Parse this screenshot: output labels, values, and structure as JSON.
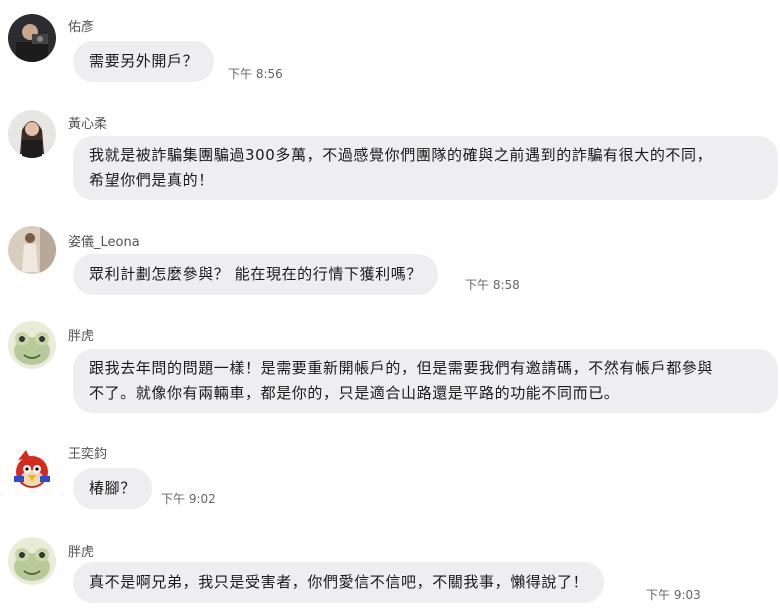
{
  "messages": [
    {
      "name": "佑彥",
      "avatar": "man-with-camera-avatar",
      "lines": [
        "需要另外開戶？"
      ],
      "time": "下午 8:56"
    },
    {
      "name": "黃心柔",
      "avatar": "woman-avatar",
      "lines": [
        "我就是被詐騙集團騙過300多萬，不過感覺你們團隊的確與之前遇到的詐騙有很大的不同，",
        "希望你們是真的！"
      ],
      "time": ""
    },
    {
      "name": "姿儀_Leona",
      "avatar": "woman-standing-avatar",
      "lines": [
        "眾利計劃怎麼參與？ 能在現在的行情下獲利嗎？"
      ],
      "time": "下午 8:58"
    },
    {
      "name": "胖虎",
      "avatar": "frog-avatar",
      "lines": [
        "跟我去年問的問題一樣！是需要重新開帳戶的，但是需要我們有邀請碼，不然有帳戶都參與",
        "不了。就像你有兩輛車，都是你的，只是適合山路還是平路的功能不同而已。"
      ],
      "time": ""
    },
    {
      "name": "王奕鈞",
      "avatar": "angry-bird-avatar",
      "lines": [
        "椿腳？"
      ],
      "time": "下午 9:02"
    },
    {
      "name": "胖虎",
      "avatar": "frog-avatar",
      "lines": [
        "真不是啊兄弟，我只是受害者，你們愛信不信吧，不關我事，懶得說了！"
      ],
      "time": "下午 9:03"
    }
  ]
}
